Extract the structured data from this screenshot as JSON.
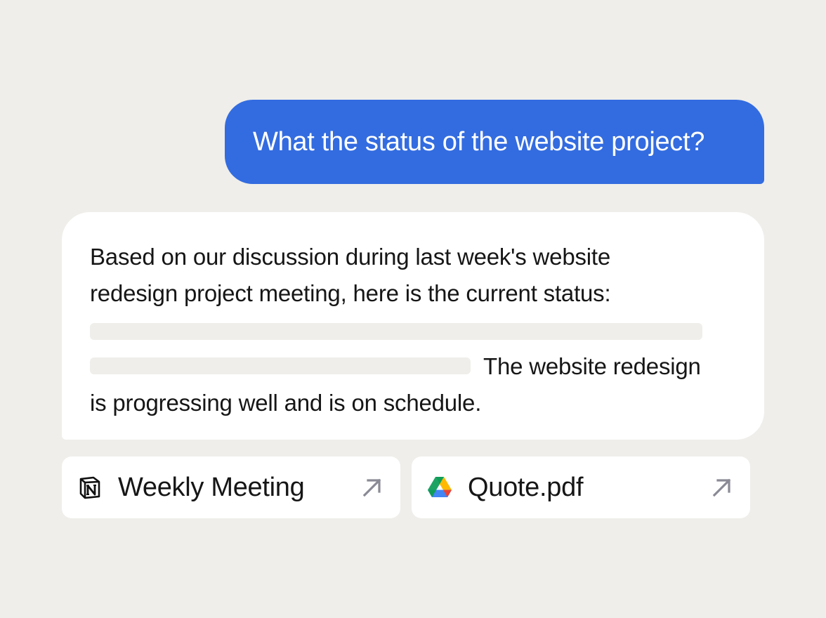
{
  "chat": {
    "user_message": "What the status of the website project?",
    "assistant_message": {
      "line1": "Based on our discussion during last week's website",
      "line2": "redesign project meeting, here is the current status:",
      "line4_tail": "The website redesign",
      "line5": "is progressing well and is on schedule."
    }
  },
  "sources": [
    {
      "label": "Weekly Meeting",
      "icon": "notion-icon",
      "action_icon": "external-link-arrow-icon"
    },
    {
      "label": "Quote.pdf",
      "icon": "google-drive-icon",
      "action_icon": "external-link-arrow-icon"
    }
  ],
  "colors": {
    "background": "#efeeea",
    "user_bubble": "#336ce0",
    "assistant_bubble": "#ffffff",
    "skeleton": "#efeeea",
    "arrow": "#8a8a96"
  }
}
